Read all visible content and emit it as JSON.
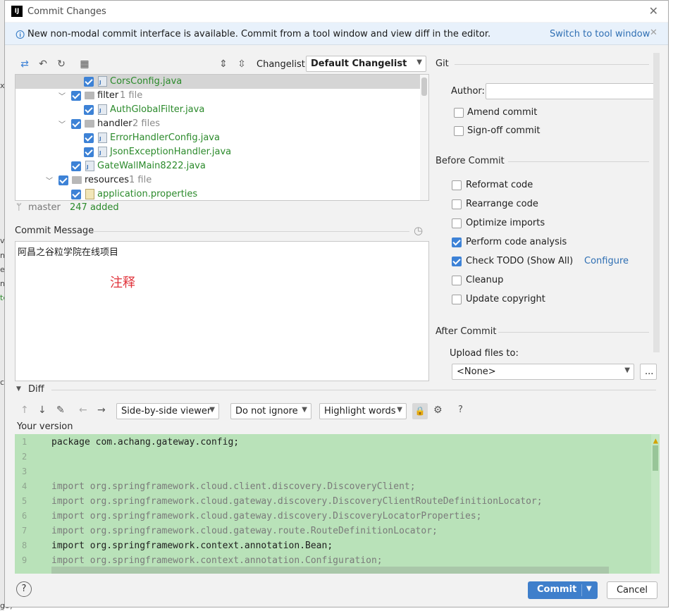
{
  "window": {
    "title": "Commit Changes",
    "app_icon": "IJ"
  },
  "banner": {
    "message": "New non-modal commit interface is available. Commit from a tool window and view diff in the editor.",
    "link": "Switch to tool window"
  },
  "toolbar": {
    "changelist_label": "Changelist:",
    "changelist_value": "Default Changelist"
  },
  "tree": {
    "rows": [
      {
        "name": "CorsConfig.java",
        "count": "",
        "kind": "java"
      },
      {
        "name": "filter",
        "count": "1 file",
        "kind": "folder"
      },
      {
        "name": "AuthGlobalFilter.java",
        "count": "",
        "kind": "java"
      },
      {
        "name": "handler",
        "count": "2 files",
        "kind": "folder"
      },
      {
        "name": "ErrorHandlerConfig.java",
        "count": "",
        "kind": "java"
      },
      {
        "name": "JsonExceptionHandler.java",
        "count": "",
        "kind": "java"
      },
      {
        "name": "GateWallMain8222.java",
        "count": "",
        "kind": "java"
      },
      {
        "name": "resources",
        "count": "1 file",
        "kind": "folder"
      },
      {
        "name": "application.properties",
        "count": "",
        "kind": "properties"
      }
    ]
  },
  "status": {
    "branch": "master",
    "added": "247 added"
  },
  "commit_message": {
    "label": "Commit Message",
    "text": "阿昌之谷粒学院在线项目",
    "note": "注释"
  },
  "git": {
    "header": "Git",
    "author_label": "Author:",
    "author_value": "",
    "amend": "Amend commit",
    "signoff": "Sign-off commit"
  },
  "before_commit": {
    "header": "Before Commit",
    "options": [
      {
        "label": "Reformat code",
        "checked": false
      },
      {
        "label": "Rearrange code",
        "checked": false
      },
      {
        "label": "Optimize imports",
        "checked": false
      },
      {
        "label": "Perform code analysis",
        "checked": true
      },
      {
        "label": "Check TODO (Show All)",
        "checked": true,
        "link": "Configure"
      },
      {
        "label": "Cleanup",
        "checked": false
      },
      {
        "label": "Update copyright",
        "checked": false
      }
    ]
  },
  "after_commit": {
    "header": "After Commit",
    "upload_label": "Upload files to:",
    "upload_value": "<None>",
    "more": "..."
  },
  "diff": {
    "header": "Diff",
    "viewer": "Side-by-side viewer",
    "ignore": "Do not ignore",
    "highlight": "Highlight words",
    "your_version": "Your version",
    "help": "?"
  },
  "code": {
    "lines": [
      {
        "n": "1",
        "text": "package com.achang.gateway.config;"
      },
      {
        "n": "2",
        "text": ""
      },
      {
        "n": "3",
        "text": ""
      },
      {
        "n": "4",
        "text": "import org.springframework.cloud.client.discovery.DiscoveryClient;"
      },
      {
        "n": "5",
        "text": "import org.springframework.cloud.gateway.discovery.DiscoveryClientRouteDefinitionLocator;"
      },
      {
        "n": "6",
        "text": "import org.springframework.cloud.gateway.discovery.DiscoveryLocatorProperties;"
      },
      {
        "n": "7",
        "text": "import org.springframework.cloud.gateway.route.RouteDefinitionLocator;"
      },
      {
        "n": "8",
        "text": "import org.springframework.context.annotation.Bean;"
      },
      {
        "n": "9",
        "text": "import org.springframework.context.annotation.Configuration;"
      }
    ]
  },
  "buttons": {
    "commit": "Commit",
    "cancel": "Cancel",
    "help": "?"
  },
  "background": {
    "fragments": [
      "xu",
      "va",
      "ne",
      "er",
      "nc",
      "te",
      "cl",
      "go)"
    ]
  }
}
